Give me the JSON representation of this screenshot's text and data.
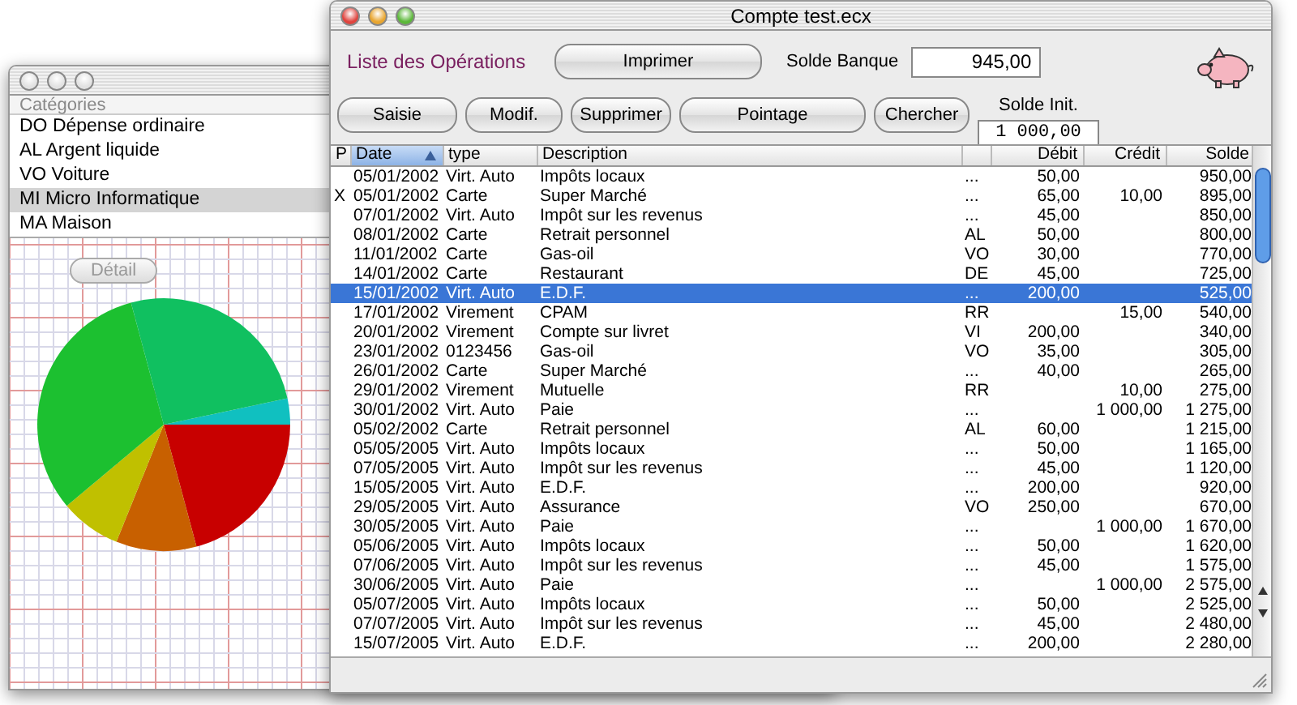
{
  "category_window": {
    "active": false,
    "list_header": "Catégories",
    "categories": [
      {
        "label": "DO Dépense ordinaire",
        "selected": false
      },
      {
        "label": "AL Argent liquide",
        "selected": false
      },
      {
        "label": "VO Voiture",
        "selected": false
      },
      {
        "label": "MI Micro Informatique",
        "selected": true
      },
      {
        "label": "MA Maison",
        "selected": false
      }
    ],
    "detail_button": {
      "label": "Détail",
      "disabled": true
    }
  },
  "account_window": {
    "active": true,
    "title": "Compte test.ecx",
    "heading": "Liste des Opérations",
    "print_button": "Imprimer",
    "bank_balance": {
      "label": "Solde Banque",
      "value": "945,00"
    },
    "buttons": [
      "Saisie",
      "Modif.",
      "Supprimer",
      "Pointage",
      "Chercher"
    ],
    "initial_balance": {
      "label": "Solde Init.",
      "value": "1 000,00"
    },
    "table": {
      "columns": [
        {
          "label": "P",
          "sorted": false
        },
        {
          "label": "Date",
          "sorted": true
        },
        {
          "label": "type",
          "sorted": false
        },
        {
          "label": "Description",
          "sorted": false
        },
        {
          "sorted": false
        },
        {
          "label": "Débit",
          "sorted": false
        },
        {
          "label": "Crédit",
          "sorted": false
        },
        {
          "label": "Solde",
          "sorted": false
        }
      ],
      "rows": [
        {
          "date": "05/01/2002",
          "type": "Virt. Auto",
          "description": "Impôts locaux",
          "code": "...",
          "debit": "50,00",
          "balance": "950,00",
          "selected": false
        },
        {
          "p": "X",
          "date": "05/01/2002",
          "type": "Carte",
          "description": "Super Marché",
          "code": "...",
          "debit": "65,00",
          "credit": "10,00",
          "balance": "895,00",
          "selected": false
        },
        {
          "date": "07/01/2002",
          "type": "Virt. Auto",
          "description": "Impôt sur les revenus",
          "code": "...",
          "debit": "45,00",
          "balance": "850,00",
          "selected": false
        },
        {
          "date": "08/01/2002",
          "type": "Carte",
          "description": "Retrait personnel",
          "code": "AL",
          "debit": "50,00",
          "balance": "800,00",
          "selected": false
        },
        {
          "date": "11/01/2002",
          "type": "Carte",
          "description": "Gas-oil",
          "code": "VO",
          "debit": "30,00",
          "balance": "770,00",
          "selected": false
        },
        {
          "date": "14/01/2002",
          "type": "Carte",
          "description": "Restaurant",
          "code": "DE",
          "debit": "45,00",
          "balance": "725,00",
          "selected": false
        },
        {
          "date": "15/01/2002",
          "type": "Virt. Auto",
          "description": "E.D.F.",
          "code": "...",
          "debit": "200,00",
          "balance": "525,00",
          "selected": true
        },
        {
          "date": "17/01/2002",
          "type": "Virement",
          "description": "CPAM",
          "code": "RR",
          "credit": "15,00",
          "balance": "540,00",
          "selected": false
        },
        {
          "date": "20/01/2002",
          "type": "Virement",
          "description": "Compte sur livret",
          "code": "VI",
          "debit": "200,00",
          "balance": "340,00",
          "selected": false
        },
        {
          "date": "23/01/2002",
          "type": "0123456",
          "description": "Gas-oil",
          "code": "VO",
          "debit": "35,00",
          "balance": "305,00",
          "selected": false
        },
        {
          "date": "26/01/2002",
          "type": "Carte",
          "description": "Super Marché",
          "code": "...",
          "debit": "40,00",
          "balance": "265,00",
          "selected": false
        },
        {
          "date": "29/01/2002",
          "type": "Virement",
          "description": "Mutuelle",
          "code": "RR",
          "credit": "10,00",
          "balance": "275,00",
          "selected": false
        },
        {
          "date": "30/01/2002",
          "type": "Virt. Auto",
          "description": "Paie",
          "code": "...",
          "credit": "1 000,00",
          "balance": "1 275,00",
          "selected": false
        },
        {
          "date": "05/02/2002",
          "type": "Carte",
          "description": "Retrait personnel",
          "code": "AL",
          "debit": "60,00",
          "balance": "1 215,00",
          "selected": false
        },
        {
          "date": "05/05/2005",
          "type": "Virt. Auto",
          "description": "Impôts locaux",
          "code": "...",
          "debit": "50,00",
          "balance": "1 165,00",
          "selected": false
        },
        {
          "date": "07/05/2005",
          "type": "Virt. Auto",
          "description": "Impôt sur les revenus",
          "code": "...",
          "debit": "45,00",
          "balance": "1 120,00",
          "selected": false
        },
        {
          "date": "15/05/2005",
          "type": "Virt. Auto",
          "description": "E.D.F.",
          "code": "...",
          "debit": "200,00",
          "balance": "920,00",
          "selected": false
        },
        {
          "date": "29/05/2005",
          "type": "Virt. Auto",
          "description": "Assurance",
          "code": "VO",
          "debit": "250,00",
          "balance": "670,00",
          "selected": false
        },
        {
          "date": "30/05/2005",
          "type": "Virt. Auto",
          "description": "Paie",
          "code": "...",
          "credit": "1 000,00",
          "balance": "1 670,00",
          "selected": false
        },
        {
          "date": "05/06/2005",
          "type": "Virt. Auto",
          "description": "Impôts locaux",
          "code": "...",
          "debit": "50,00",
          "balance": "1 620,00",
          "selected": false
        },
        {
          "date": "07/06/2005",
          "type": "Virt. Auto",
          "description": "Impôt sur les revenus",
          "code": "...",
          "debit": "45,00",
          "balance": "1 575,00",
          "selected": false
        },
        {
          "date": "30/06/2005",
          "type": "Virt. Auto",
          "description": "Paie",
          "code": "...",
          "credit": "1 000,00",
          "balance": "2 575,00",
          "selected": false
        },
        {
          "date": "05/07/2005",
          "type": "Virt. Auto",
          "description": "Impôts locaux",
          "code": "...",
          "debit": "50,00",
          "balance": "2 525,00",
          "selected": false
        },
        {
          "date": "07/07/2005",
          "type": "Virt. Auto",
          "description": "Impôt sur les revenus",
          "code": "...",
          "debit": "45,00",
          "balance": "2 480,00",
          "selected": false
        },
        {
          "date": "15/07/2005",
          "type": "Virt. Auto",
          "description": "E.D.F.",
          "code": "...",
          "debit": "200,00",
          "balance": "2 280,00",
          "selected": false
        }
      ]
    }
  }
}
